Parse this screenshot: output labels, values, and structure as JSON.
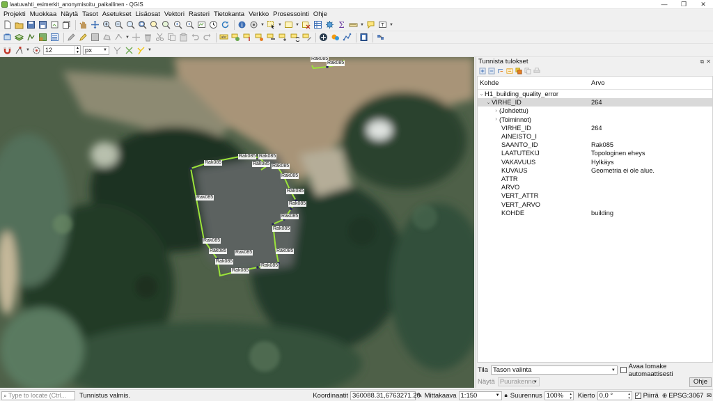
{
  "window": {
    "title": "laatuvahti_esimerkit_anonymisoitu_paikallinen - QGIS",
    "minimize": "—",
    "maximize": "❐",
    "close": "✕"
  },
  "menu": [
    "Projekti",
    "Muokkaa",
    "Näytä",
    "Tasot",
    "Asetukset",
    "Lisäosat",
    "Vektori",
    "Rasteri",
    "Tietokanta",
    "Verkko",
    "Prosessointi",
    "Ohje"
  ],
  "snapping": {
    "tolerance": "12",
    "unit": "px"
  },
  "map": {
    "feature_label": "Rak085"
  },
  "panel": {
    "title": "Tunnista tulokset",
    "columns": {
      "feature": "Kohde",
      "value": "Arvo"
    },
    "layer": "H1_building_quality_error",
    "feature": {
      "key": "VIRHE_ID",
      "value": "264"
    },
    "groups": [
      "(Johdettu)",
      "(Toiminnot)"
    ],
    "attributes": [
      {
        "name": "VIRHE_ID",
        "value": "264"
      },
      {
        "name": "AINEISTO_I",
        "value": ""
      },
      {
        "name": "SAANTO_ID",
        "value": "Rak085"
      },
      {
        "name": "LAATUTEKIJ",
        "value": "Topologinen eheys"
      },
      {
        "name": "VAKAVUUS",
        "value": "Hylkäys"
      },
      {
        "name": "KUVAUS",
        "value": "Geometria ei ole alue."
      },
      {
        "name": "ATTR",
        "value": ""
      },
      {
        "name": "ARVO",
        "value": ""
      },
      {
        "name": "VERT_ATTR",
        "value": ""
      },
      {
        "name": "VERT_ARVO",
        "value": ""
      },
      {
        "name": "KOHDE",
        "value": "building"
      }
    ],
    "mode_label": "Tila",
    "mode_value": "Tason valinta",
    "auto_open_label": "Avaa lomake automaattisesti",
    "view_label": "Näytä",
    "view_value": "Puurakenne",
    "help_label": "Ohje"
  },
  "status": {
    "locator_placeholder": "Type to locate (Ctrl...",
    "message": "Tunnistus valmis.",
    "coord_label": "Koordinaatit",
    "coord_value": "360088.31,6763271.20",
    "scale_label": "Mittakaava",
    "scale_value": "1:150",
    "magnifier_label": "Suurennus",
    "magnifier_value": "100%",
    "rotation_label": "Kierto",
    "rotation_value": "0,0 °",
    "render_label": "Piirrä",
    "crs": "EPSG:3067"
  },
  "colors": {
    "selection_outline": "#9be33a",
    "vertex": "#27235a",
    "tree_selection": "#d9d9d9"
  }
}
